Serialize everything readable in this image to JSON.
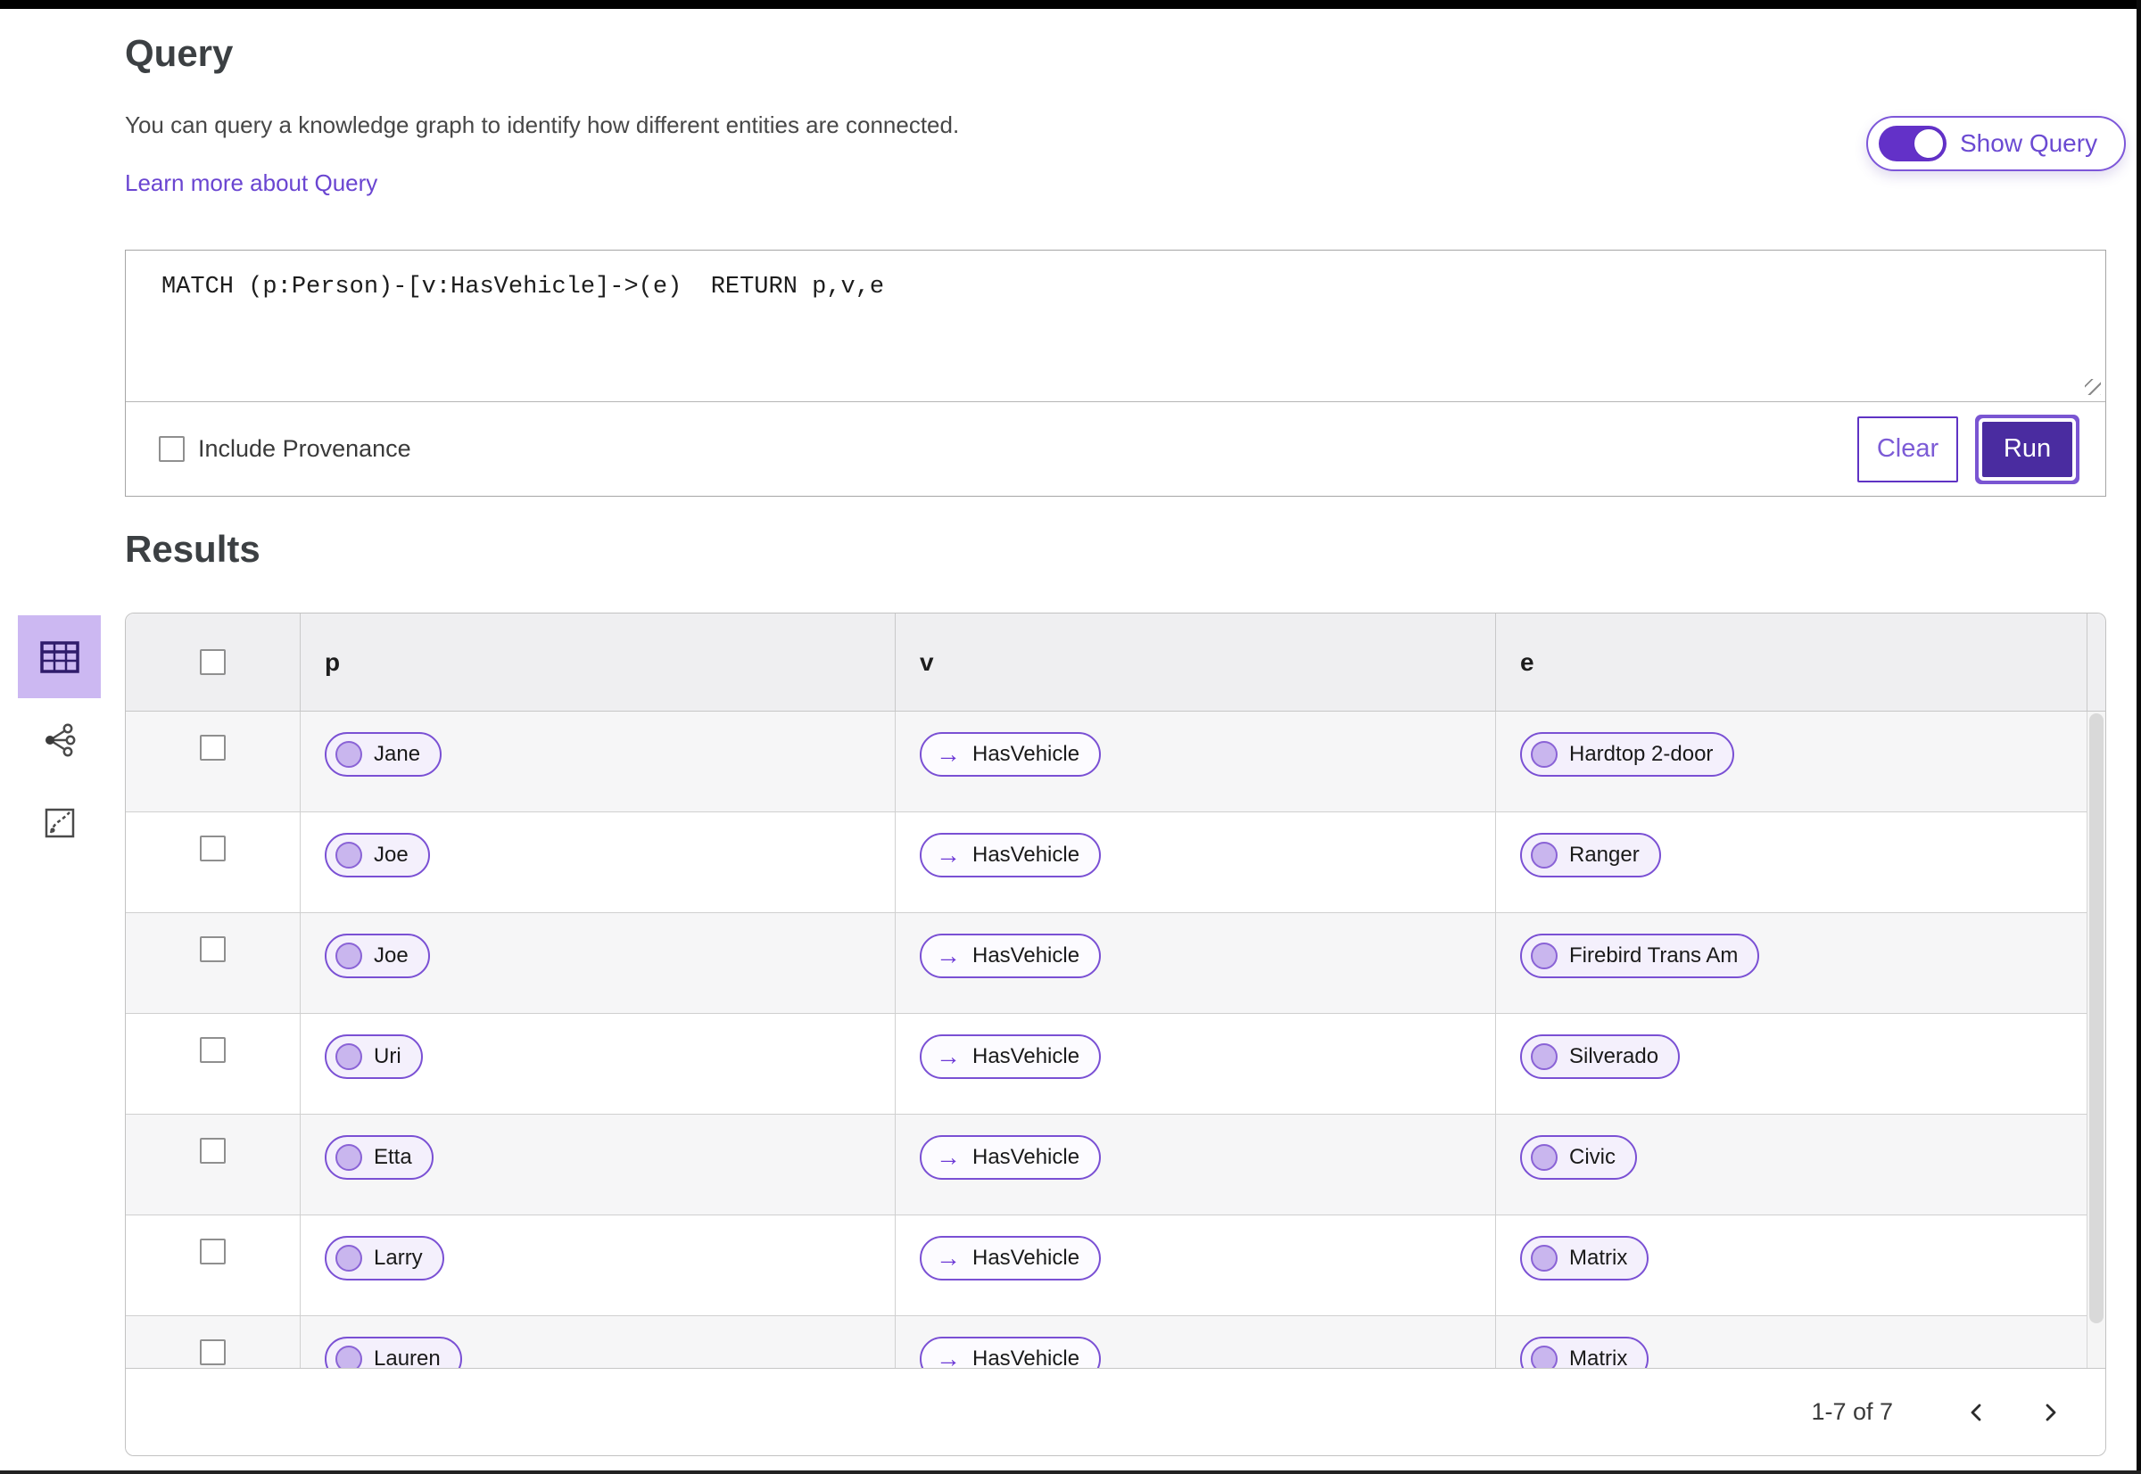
{
  "colors": {
    "accent_purple": "#6331c8",
    "run_button_fill": "#4a2ca0",
    "pill_border": "#7a50d4",
    "active_view_background": "#ccb8f2",
    "link": "#6a45d1"
  },
  "query": {
    "title": "Query",
    "description": "You can query a knowledge graph to identify how different entities are connected.",
    "learn_more_label": "Learn more about Query",
    "show_query_label": "Show Query",
    "editor_text": "MATCH (p:Person)-[v:HasVehicle]->(e)  RETURN p,v,e",
    "include_provenance_label": "Include Provenance",
    "clear_label": "Clear",
    "run_label": "Run"
  },
  "icons": {
    "arrow_right": "→",
    "view_icons": [
      "table-view-icon",
      "graph-view-icon",
      "scatter-view-icon"
    ]
  },
  "results": {
    "title": "Results",
    "table": {
      "columns": [
        "p",
        "v",
        "e"
      ],
      "rows": [
        {
          "p": "Jane",
          "v": "HasVehicle",
          "e": "Hardtop 2-door"
        },
        {
          "p": "Joe",
          "v": "HasVehicle",
          "e": "Ranger"
        },
        {
          "p": "Joe",
          "v": "HasVehicle",
          "e": "Firebird Trans Am"
        },
        {
          "p": "Uri",
          "v": "HasVehicle",
          "e": "Silverado"
        },
        {
          "p": "Etta",
          "v": "HasVehicle",
          "e": "Civic"
        },
        {
          "p": "Larry",
          "v": "HasVehicle",
          "e": "Matrix"
        },
        {
          "p": "Lauren",
          "v": "HasVehicle",
          "e": "Matrix"
        }
      ]
    },
    "pagination": {
      "range_label": "1-7 of 7"
    }
  }
}
